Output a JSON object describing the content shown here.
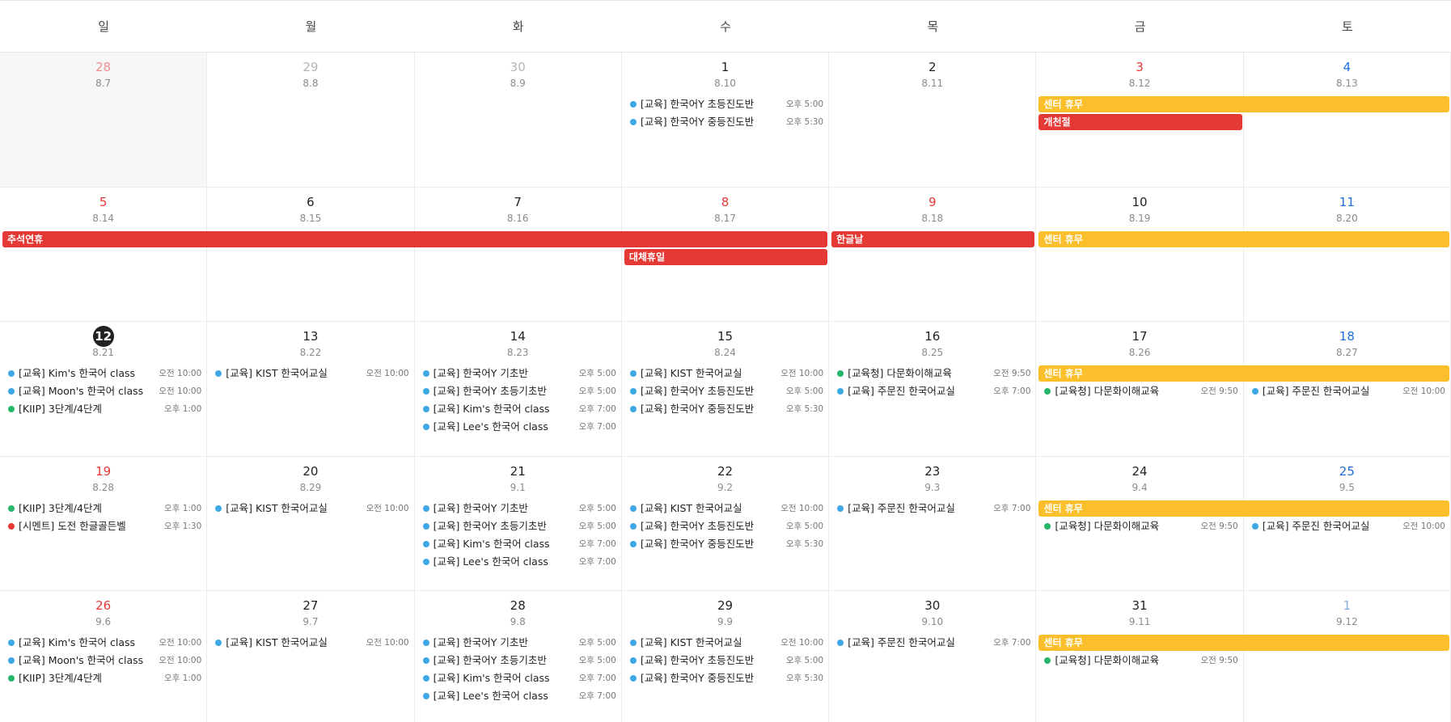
{
  "calendar": {
    "weekday_headers": [
      "일",
      "월",
      "화",
      "수",
      "목",
      "금",
      "토"
    ],
    "colors": {
      "holiday_red": "#e53935",
      "center_yellow": "#fbbf2b",
      "dot_blue": "#3ea8e5",
      "dot_green": "#27b56a",
      "dot_red": "#e53935"
    },
    "weeks": [
      {
        "days": [
          {
            "num": "28",
            "lunar": "8.7",
            "cls": "muted-sun",
            "other": true,
            "events": []
          },
          {
            "num": "29",
            "lunar": "8.8",
            "cls": "muted",
            "other": false,
            "events": []
          },
          {
            "num": "30",
            "lunar": "8.9",
            "cls": "muted",
            "other": false,
            "events": []
          },
          {
            "num": "1",
            "lunar": "8.10",
            "cls": "",
            "other": false,
            "events": [
              {
                "color": "blue",
                "title": "[교육] 한국어Y 초등진도반",
                "time": "오후 5:00"
              },
              {
                "color": "blue",
                "title": "[교육] 한국어Y 중등진도반",
                "time": "오후 5:30"
              }
            ]
          },
          {
            "num": "2",
            "lunar": "8.11",
            "cls": "",
            "other": false,
            "events": []
          },
          {
            "num": "3",
            "lunar": "8.12",
            "cls": "sun",
            "other": false,
            "events": []
          },
          {
            "num": "4",
            "lunar": "8.13",
            "cls": "sat",
            "other": false,
            "events": []
          }
        ],
        "bars": [
          {
            "label": "센터 휴무",
            "color": "center_yellow",
            "start": 5,
            "span": 2,
            "lane": 0
          },
          {
            "label": "개천절",
            "color": "holiday_red",
            "start": 5,
            "span": 1,
            "lane": 1
          }
        ]
      },
      {
        "days": [
          {
            "num": "5",
            "lunar": "8.14",
            "cls": "sun",
            "other": false,
            "events": []
          },
          {
            "num": "6",
            "lunar": "8.15",
            "cls": "",
            "other": false,
            "events": []
          },
          {
            "num": "7",
            "lunar": "8.16",
            "cls": "",
            "other": false,
            "events": []
          },
          {
            "num": "8",
            "lunar": "8.17",
            "cls": "sun",
            "other": false,
            "events": []
          },
          {
            "num": "9",
            "lunar": "8.18",
            "cls": "sun",
            "other": false,
            "events": []
          },
          {
            "num": "10",
            "lunar": "8.19",
            "cls": "",
            "other": false,
            "events": []
          },
          {
            "num": "11",
            "lunar": "8.20",
            "cls": "sat",
            "other": false,
            "events": []
          }
        ],
        "bars": [
          {
            "label": "추석연휴",
            "color": "holiday_red",
            "start": 0,
            "span": 4,
            "lane": 0
          },
          {
            "label": "한글날",
            "color": "holiday_red",
            "start": 4,
            "span": 1,
            "lane": 0
          },
          {
            "label": "센터 휴무",
            "color": "center_yellow",
            "start": 5,
            "span": 2,
            "lane": 0
          },
          {
            "label": "대체휴일",
            "color": "holiday_red",
            "start": 3,
            "span": 1,
            "lane": 1
          }
        ]
      },
      {
        "days": [
          {
            "num": "12",
            "lunar": "8.21",
            "cls": "today",
            "other": false,
            "events": [
              {
                "color": "blue",
                "title": "[교육] Kim's 한국어 class",
                "time": "오전 10:00"
              },
              {
                "color": "blue",
                "title": "[교육] Moon's 한국어 class",
                "time": "오전 10:00"
              },
              {
                "color": "green",
                "title": "[KIIP] 3단계/4단계",
                "time": "오후 1:00"
              }
            ]
          },
          {
            "num": "13",
            "lunar": "8.22",
            "cls": "",
            "other": false,
            "events": [
              {
                "color": "blue",
                "title": "[교육] KIST 한국어교실",
                "time": "오전 10:00"
              }
            ]
          },
          {
            "num": "14",
            "lunar": "8.23",
            "cls": "",
            "other": false,
            "events": [
              {
                "color": "blue",
                "title": "[교육] 한국어Y 기초반",
                "time": "오후 5:00"
              },
              {
                "color": "blue",
                "title": "[교육] 한국어Y 초등기초반",
                "time": "오후 5:00"
              },
              {
                "color": "blue",
                "title": "[교육] Kim's 한국어 class",
                "time": "오후 7:00"
              },
              {
                "color": "blue",
                "title": "[교육] Lee's 한국어 class",
                "time": "오후 7:00"
              }
            ]
          },
          {
            "num": "15",
            "lunar": "8.24",
            "cls": "",
            "other": false,
            "events": [
              {
                "color": "blue",
                "title": "[교육] KIST 한국어교실",
                "time": "오전 10:00"
              },
              {
                "color": "blue",
                "title": "[교육] 한국어Y 초등진도반",
                "time": "오후 5:00"
              },
              {
                "color": "blue",
                "title": "[교육] 한국어Y 중등진도반",
                "time": "오후 5:30"
              }
            ]
          },
          {
            "num": "16",
            "lunar": "8.25",
            "cls": "",
            "other": false,
            "events": [
              {
                "color": "green",
                "title": "[교육청] 다문화이해교육",
                "time": "오전 9:50"
              },
              {
                "color": "blue",
                "title": "[교육] 주문진 한국어교실",
                "time": "오후 7:00"
              }
            ]
          },
          {
            "num": "17",
            "lunar": "8.26",
            "cls": "",
            "other": false,
            "events": [
              {
                "color": "green",
                "title": "[교육청] 다문화이해교육",
                "time": "오전 9:50",
                "lane": 1
              }
            ]
          },
          {
            "num": "18",
            "lunar": "8.27",
            "cls": "sat",
            "other": false,
            "events": [
              {
                "color": "blue",
                "title": "[교육] 주문진 한국어교실",
                "time": "오전 10:00",
                "lane": 1
              }
            ]
          }
        ],
        "bars": [
          {
            "label": "센터 휴무",
            "color": "center_yellow",
            "start": 5,
            "span": 2,
            "lane": 0
          }
        ]
      },
      {
        "days": [
          {
            "num": "19",
            "lunar": "8.28",
            "cls": "sun",
            "other": false,
            "events": [
              {
                "color": "green",
                "title": "[KIIP] 3단계/4단계",
                "time": "오후 1:00"
              },
              {
                "color": "red",
                "title": "[시멘트] 도전 한글골든벨",
                "time": "오후 1:30"
              }
            ]
          },
          {
            "num": "20",
            "lunar": "8.29",
            "cls": "",
            "other": false,
            "events": [
              {
                "color": "blue",
                "title": "[교육] KIST 한국어교실",
                "time": "오전 10:00"
              }
            ]
          },
          {
            "num": "21",
            "lunar": "9.1",
            "cls": "",
            "other": false,
            "events": [
              {
                "color": "blue",
                "title": "[교육] 한국어Y 기초반",
                "time": "오후 5:00"
              },
              {
                "color": "blue",
                "title": "[교육] 한국어Y 초등기초반",
                "time": "오후 5:00"
              },
              {
                "color": "blue",
                "title": "[교육] Kim's 한국어 class",
                "time": "오후 7:00"
              },
              {
                "color": "blue",
                "title": "[교육] Lee's 한국어 class",
                "time": "오후 7:00"
              }
            ]
          },
          {
            "num": "22",
            "lunar": "9.2",
            "cls": "",
            "other": false,
            "events": [
              {
                "color": "blue",
                "title": "[교육] KIST 한국어교실",
                "time": "오전 10:00"
              },
              {
                "color": "blue",
                "title": "[교육] 한국어Y 초등진도반",
                "time": "오후 5:00"
              },
              {
                "color": "blue",
                "title": "[교육] 한국어Y 중등진도반",
                "time": "오후 5:30"
              }
            ]
          },
          {
            "num": "23",
            "lunar": "9.3",
            "cls": "",
            "other": false,
            "events": [
              {
                "color": "blue",
                "title": "[교육] 주문진 한국어교실",
                "time": "오후 7:00"
              }
            ]
          },
          {
            "num": "24",
            "lunar": "9.4",
            "cls": "",
            "other": false,
            "events": [
              {
                "color": "green",
                "title": "[교육청] 다문화이해교육",
                "time": "오전 9:50",
                "lane": 1
              }
            ]
          },
          {
            "num": "25",
            "lunar": "9.5",
            "cls": "sat",
            "other": false,
            "events": [
              {
                "color": "blue",
                "title": "[교육] 주문진 한국어교실",
                "time": "오전 10:00",
                "lane": 1
              }
            ]
          }
        ],
        "bars": [
          {
            "label": "센터 휴무",
            "color": "center_yellow",
            "start": 5,
            "span": 2,
            "lane": 0
          }
        ]
      },
      {
        "days": [
          {
            "num": "26",
            "lunar": "9.6",
            "cls": "sun",
            "other": false,
            "events": [
              {
                "color": "blue",
                "title": "[교육] Kim's 한국어 class",
                "time": "오전 10:00"
              },
              {
                "color": "blue",
                "title": "[교육] Moon's 한국어 class",
                "time": "오전 10:00"
              },
              {
                "color": "green",
                "title": "[KIIP] 3단계/4단계",
                "time": "오후 1:00"
              }
            ]
          },
          {
            "num": "27",
            "lunar": "9.7",
            "cls": "",
            "other": false,
            "events": [
              {
                "color": "blue",
                "title": "[교육] KIST 한국어교실",
                "time": "오전 10:00"
              }
            ]
          },
          {
            "num": "28",
            "lunar": "9.8",
            "cls": "",
            "other": false,
            "events": [
              {
                "color": "blue",
                "title": "[교육] 한국어Y 기초반",
                "time": "오후 5:00"
              },
              {
                "color": "blue",
                "title": "[교육] 한국어Y 초등기초반",
                "time": "오후 5:00"
              },
              {
                "color": "blue",
                "title": "[교육] Kim's 한국어 class",
                "time": "오후 7:00"
              },
              {
                "color": "blue",
                "title": "[교육] Lee's 한국어 class",
                "time": "오후 7:00"
              }
            ]
          },
          {
            "num": "29",
            "lunar": "9.9",
            "cls": "",
            "other": false,
            "events": [
              {
                "color": "blue",
                "title": "[교육] KIST 한국어교실",
                "time": "오전 10:00"
              },
              {
                "color": "blue",
                "title": "[교육] 한국어Y 초등진도반",
                "time": "오후 5:00"
              },
              {
                "color": "blue",
                "title": "[교육] 한국어Y 중등진도반",
                "time": "오후 5:30"
              }
            ]
          },
          {
            "num": "30",
            "lunar": "9.10",
            "cls": "",
            "other": false,
            "events": [
              {
                "color": "blue",
                "title": "[교육] 주문진 한국어교실",
                "time": "오후 7:00"
              }
            ]
          },
          {
            "num": "31",
            "lunar": "9.11",
            "cls": "",
            "other": false,
            "events": [
              {
                "color": "green",
                "title": "[교육청] 다문화이해교육",
                "time": "오전 9:50",
                "lane": 1
              }
            ]
          },
          {
            "num": "1",
            "lunar": "9.12",
            "cls": "muted-sat",
            "other": false,
            "events": []
          }
        ],
        "bars": [
          {
            "label": "센터 휴무",
            "color": "center_yellow",
            "start": 5,
            "span": 2,
            "lane": 0
          }
        ]
      }
    ]
  }
}
